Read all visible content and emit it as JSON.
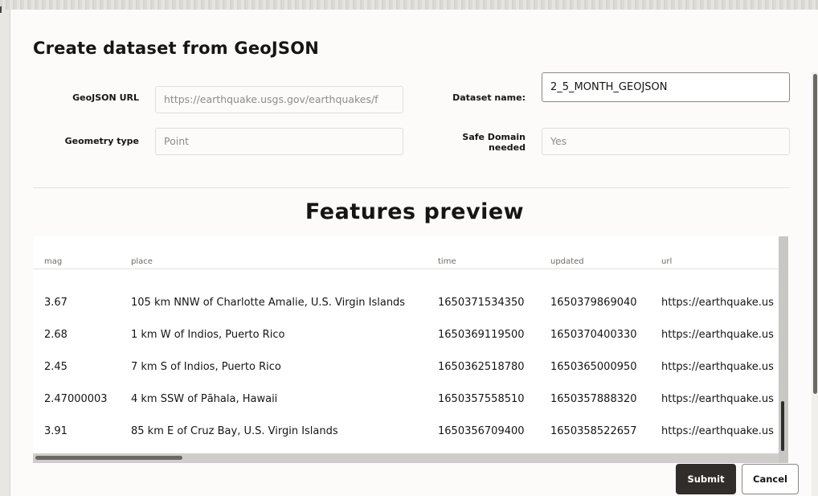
{
  "dialog": {
    "title": "Create dataset from GeoJSON"
  },
  "form": {
    "geojson_url": {
      "label": "GeoJSON URL",
      "value": "https://earthquake.usgs.gov/earthquakes/f"
    },
    "dataset_name": {
      "label": "Dataset name:",
      "value": "2_5_MONTH_GEOJSON"
    },
    "geometry_type": {
      "label": "Geometry type",
      "value": "Point"
    },
    "safe_domain": {
      "label_line1": "Safe Domain",
      "label_line2": "needed",
      "value": "Yes"
    }
  },
  "preview": {
    "title": "Features preview",
    "columns": [
      "mag",
      "place",
      "time",
      "updated",
      "url"
    ],
    "rows": [
      {
        "mag": "3.67",
        "place": "105 km NNW of Charlotte Amalie, U.S. Virgin Islands",
        "time": "1650371534350",
        "updated": "1650379869040",
        "url": "https://earthquake.us"
      },
      {
        "mag": "2.68",
        "place": "1 km W of Indios, Puerto Rico",
        "time": "1650369119500",
        "updated": "1650370400330",
        "url": "https://earthquake.us"
      },
      {
        "mag": "2.45",
        "place": "7 km S of Indios, Puerto Rico",
        "time": "1650362518780",
        "updated": "1650365000950",
        "url": "https://earthquake.us"
      },
      {
        "mag": "2.47000003",
        "place": "4 km SSW of Pāhala, Hawaii",
        "time": "1650357558510",
        "updated": "1650357888320",
        "url": "https://earthquake.us"
      },
      {
        "mag": "3.91",
        "place": "85 km E of Cruz Bay, U.S. Virgin Islands",
        "time": "1650356709400",
        "updated": "1650358522657",
        "url": "https://earthquake.us"
      }
    ]
  },
  "actions": {
    "submit_label": "Submit",
    "cancel_label": "Cancel"
  },
  "colors": {
    "primary_button": "#312d2a",
    "background": "#fcfbfa"
  }
}
